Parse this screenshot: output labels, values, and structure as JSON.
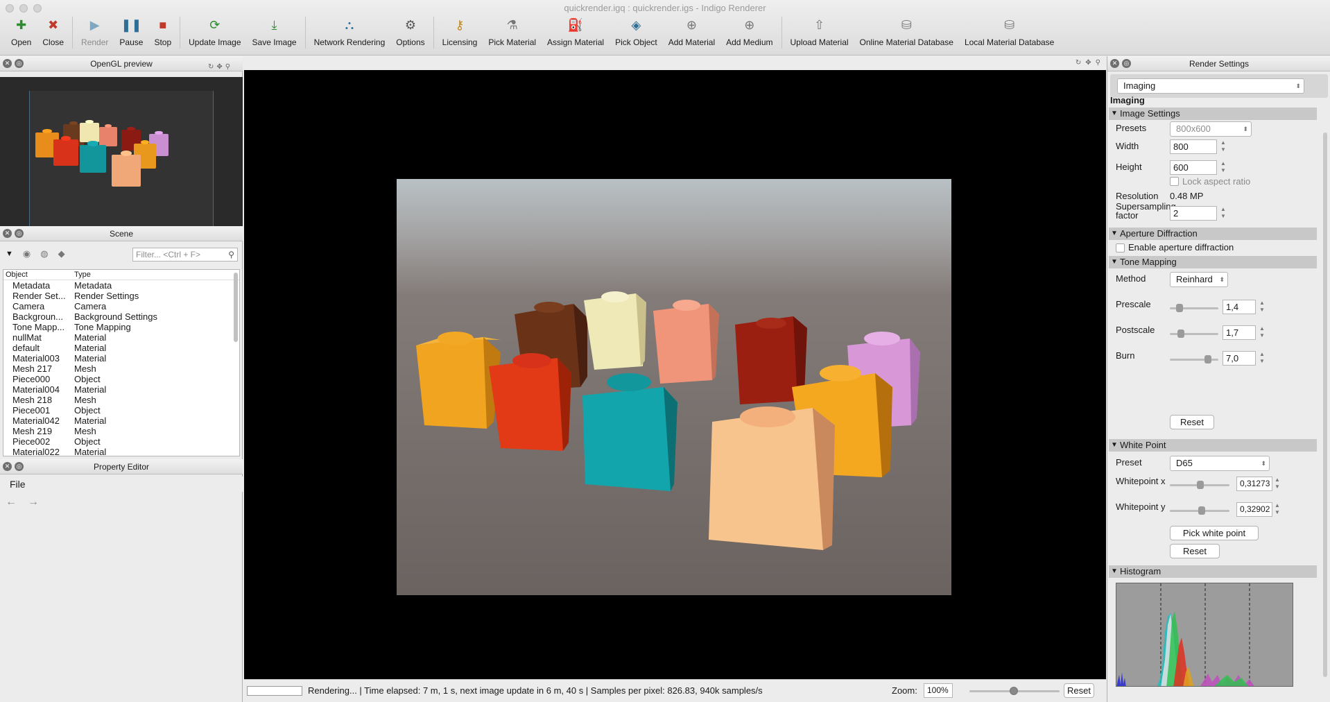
{
  "window": {
    "title": "quickrender.igq : quickrender.igs - Indigo Renderer"
  },
  "toolbar": [
    {
      "label": "Open",
      "icon": "plus-icon",
      "glyph": "✚",
      "color": "#2e8b2e",
      "disabled": false
    },
    {
      "label": "Close",
      "icon": "close-icon",
      "glyph": "✖",
      "color": "#c0392b",
      "disabled": false
    },
    {
      "sep": true
    },
    {
      "label": "Render",
      "icon": "play-icon",
      "glyph": "▶",
      "color": "#7fa7bf",
      "disabled": true
    },
    {
      "label": "Pause",
      "icon": "pause-icon",
      "glyph": "❚❚",
      "color": "#2f6f96",
      "disabled": false
    },
    {
      "label": "Stop",
      "icon": "stop-icon",
      "glyph": "■",
      "color": "#c0392b",
      "disabled": false
    },
    {
      "sep": true
    },
    {
      "label": "Update Image",
      "icon": "refresh-icon",
      "glyph": "⟳",
      "color": "#2e8b2e",
      "disabled": false
    },
    {
      "label": "Save Image",
      "icon": "download-icon",
      "glyph": "⤓",
      "color": "#2e8b2e",
      "disabled": false
    },
    {
      "sep": true
    },
    {
      "label": "Network Rendering",
      "icon": "network-icon",
      "glyph": "⛬",
      "color": "#2f6f96",
      "disabled": false
    },
    {
      "label": "Options",
      "icon": "gear-icon",
      "glyph": "⚙",
      "color": "#555555",
      "disabled": false
    },
    {
      "sep": true
    },
    {
      "label": "Licensing",
      "icon": "key-icon",
      "glyph": "⚷",
      "color": "#c08a1e",
      "disabled": false
    },
    {
      "label": "Pick Material",
      "icon": "eyedropper-icon",
      "glyph": "⚗",
      "color": "#777777",
      "disabled": false
    },
    {
      "label": "Assign Material",
      "icon": "bucket-icon",
      "glyph": "⛽",
      "color": "#777777",
      "disabled": false
    },
    {
      "label": "Pick Object",
      "icon": "fish-icon",
      "glyph": "◈",
      "color": "#2f6f96",
      "disabled": false
    },
    {
      "label": "Add Material",
      "icon": "add-material-icon",
      "glyph": "⊕",
      "color": "#777777",
      "disabled": false
    },
    {
      "label": "Add Medium",
      "icon": "add-medium-icon",
      "glyph": "⊕",
      "color": "#777777",
      "disabled": false
    },
    {
      "sep": true
    },
    {
      "label": "Upload Material",
      "icon": "upload-icon",
      "glyph": "⇧",
      "color": "#777777",
      "disabled": false
    },
    {
      "label": "Online Material Database",
      "icon": "online-db-icon",
      "glyph": "⛁",
      "color": "#777777",
      "disabled": false
    },
    {
      "label": "Local Material Database",
      "icon": "local-db-icon",
      "glyph": "⛁",
      "color": "#777777",
      "disabled": false
    }
  ],
  "left": {
    "opengl_title": "OpenGL preview",
    "scene_title": "Scene",
    "filter_placeholder": "Filter... <Ctrl + F>",
    "columns": [
      "Object",
      "Type"
    ],
    "rows": [
      [
        "Metadata",
        "Metadata"
      ],
      [
        "Render Set...",
        "Render Settings"
      ],
      [
        "Camera",
        "Camera"
      ],
      [
        "Backgroun...",
        "Background Settings"
      ],
      [
        "Tone Mapp...",
        "Tone Mapping"
      ],
      [
        "nullMat",
        "Material"
      ],
      [
        "default",
        "Material"
      ],
      [
        "Material003",
        "Material"
      ],
      [
        "Mesh 217",
        "Mesh"
      ],
      [
        "Piece000",
        "Object"
      ],
      [
        "Material004",
        "Material"
      ],
      [
        "Mesh 218",
        "Mesh"
      ],
      [
        "Piece001",
        "Object"
      ],
      [
        "Material042",
        "Material"
      ],
      [
        "Mesh 219",
        "Mesh"
      ],
      [
        "Piece002",
        "Object"
      ],
      [
        "Material022",
        "Material"
      ]
    ],
    "property_title": "Property Editor",
    "property_menu": "File"
  },
  "status": {
    "text": "Rendering... | Time elapsed: 7 m, 1 s, next image update in 6 m, 40 s | Samples per pixel: 826.83, 940k samples/s",
    "zoom_label": "Zoom:",
    "zoom_value": "100%",
    "reset": "Reset"
  },
  "right": {
    "title": "Render Settings",
    "category": "Imaging",
    "heading": "Imaging",
    "image_settings": {
      "section": "Image Settings",
      "presets_label": "Presets",
      "presets_value": "800x600",
      "width_label": "Width",
      "width_value": "800",
      "height_label": "Height",
      "height_value": "600",
      "lock_label": "Lock aspect ratio",
      "resolution_label": "Resolution",
      "resolution_value": "0.48 MP",
      "supersampling_label": "Supersampling factor",
      "supersampling_value": "2"
    },
    "aperture": {
      "section": "Aperture Diffraction",
      "enable_label": "Enable aperture diffraction"
    },
    "tone_mapping": {
      "section": "Tone Mapping",
      "method_label": "Method",
      "method_value": "Reinhard",
      "prescale_label": "Prescale",
      "prescale_value": "1,4",
      "postscale_label": "Postscale",
      "postscale_value": "1,7",
      "burn_label": "Burn",
      "burn_value": "7,0",
      "reset": "Reset"
    },
    "white_point": {
      "section": "White Point",
      "preset_label": "Preset",
      "preset_value": "D65",
      "x_label": "Whitepoint x",
      "x_value": "0,31273",
      "y_label": "Whitepoint y",
      "y_value": "0,32902",
      "pick": "Pick white point",
      "reset": "Reset"
    },
    "histogram": {
      "section": "Histogram"
    }
  }
}
